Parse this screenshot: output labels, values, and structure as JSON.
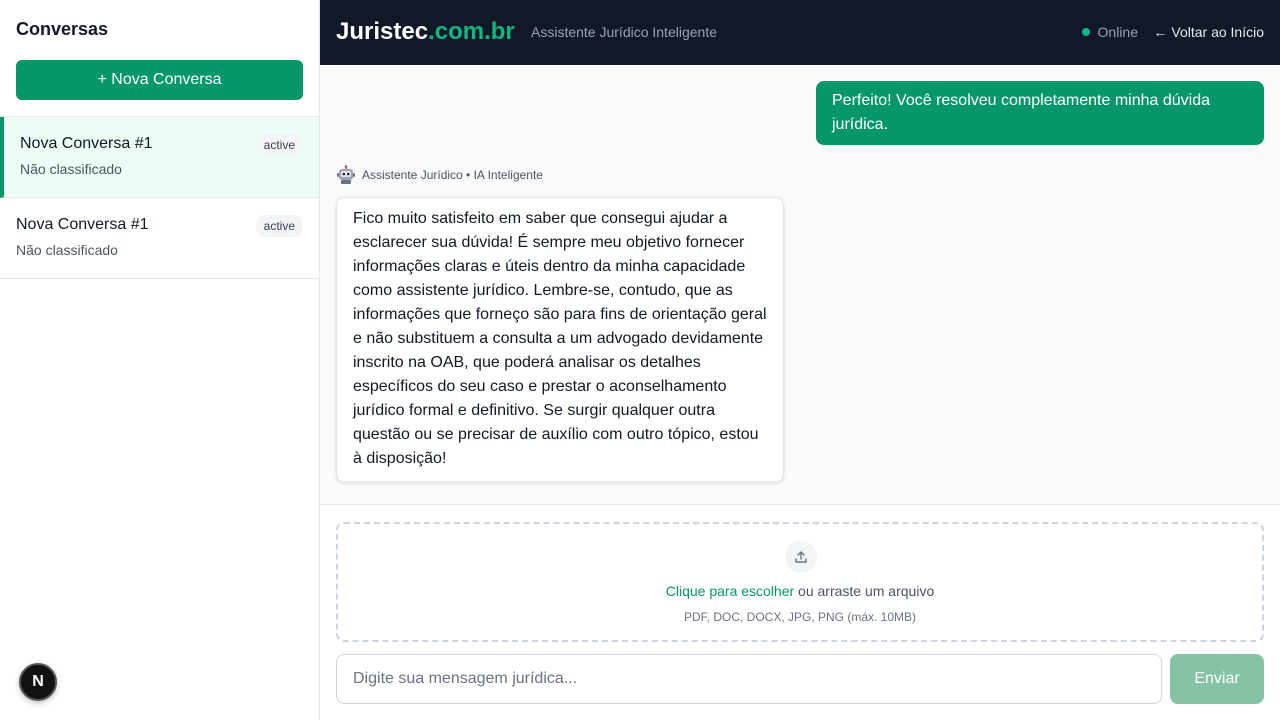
{
  "sidebar": {
    "title": "Conversas",
    "new_button": "+ Nova Conversa",
    "conversations": [
      {
        "title": "Nova Conversa #1",
        "subtitle": "Não classificado",
        "badge": "active"
      },
      {
        "title": "Nova Conversa #1",
        "subtitle": "Não classificado",
        "badge": "active"
      }
    ],
    "dev_badge": "N"
  },
  "header": {
    "brand_main": "Juristec",
    "brand_accent": ".com.br",
    "tagline": "Assistente Jurídico Inteligente",
    "status": "Online",
    "back_link": "Voltar ao Início",
    "back_arrow": "←"
  },
  "chat": {
    "user_message": "Perfeito! Você resolveu completamente minha dúvida jurídica.",
    "assistant_label": "Assistente Jurídico • IA Inteligente",
    "assistant_message": "Fico muito satisfeito em saber que consegui ajudar a esclarecer sua dúvida! É sempre meu objetivo fornecer informações claras e úteis dentro da minha capacidade como assistente jurídico. Lembre-se, contudo, que as informações que forneço são para fins de orientação geral e não substituem a consulta a um advogado devidamente inscrito na OAB, que poderá analisar os detalhes específicos do seu caso e prestar o aconselhamento jurídico formal e definitivo. Se surgir qualquer outra questão ou se precisar de auxílio com outro tópico, estou à disposição!"
  },
  "upload": {
    "link_text": "Clique para escolher",
    "rest_text": " ou arraste um arquivo",
    "hint": "PDF, DOC, DOCX, JPG, PNG (máx. 10MB)"
  },
  "composer": {
    "placeholder": "Digite sua mensagem jurídica...",
    "value": "",
    "send_label": "Enviar"
  },
  "colors": {
    "accent": "#059669",
    "header_bg": "#111827",
    "brand_accent": "#10b981",
    "send_disabled": "#86c3a6"
  },
  "icons": [
    "robot-icon",
    "upload-icon",
    "arrow-left-icon",
    "status-dot",
    "next-logo-icon"
  ]
}
